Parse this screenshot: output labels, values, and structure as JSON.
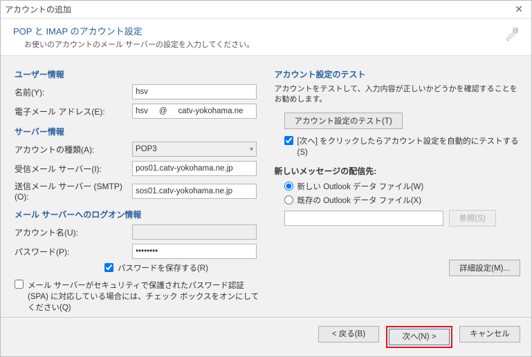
{
  "window": {
    "title": "アカウントの追加"
  },
  "header": {
    "title": "POP と IMAP のアカウント設定",
    "desc": "お使いのアカウントのメール サーバーの設定を入力してください。"
  },
  "left": {
    "user_h": "ユーザー情報",
    "name_label": "名前(Y):",
    "name_value": "hsv",
    "email_label": "電子メール アドレス(E):",
    "email_value": "hsv     @     catv-yokohama.ne",
    "server_h": "サーバー情報",
    "acct_type_label": "アカウントの種類(A):",
    "acct_type_value": "POP3",
    "incoming_label": "受信メール サーバー(I):",
    "incoming_value": "pos01.catv-yokohama.ne.jp",
    "outgoing_label": "送信メール サーバー (SMTP)(O):",
    "outgoing_value": "sos01.catv-yokohama.ne.jp",
    "logon_h": "メール サーバーへのログオン情報",
    "acct_name_label": "アカウント名(U):",
    "acct_name_value": "",
    "pwd_label": "パスワード(P):",
    "pwd_value": "••••••••",
    "remember_pwd": "パスワードを保存する(R)",
    "spa": "メール サーバーがセキュリティで保護されたパスワード認証 (SPA) に対応している場合には、チェック ボックスをオンにしてください(Q)"
  },
  "right": {
    "test_h": "アカウント設定のテスト",
    "test_desc": "アカウントをテストして、入力内容が正しいかどうかを確認することをお勧めします。",
    "test_btn": "アカウント設定のテスト(T)",
    "auto_test": "[次へ] をクリックしたらアカウント設定を自動的にテストする(S)",
    "deliver_h": "新しいメッセージの配信先:",
    "new_pst": "新しい Outlook データ ファイル(W)",
    "existing_pst": "既存の Outlook データ ファイル(X)",
    "browse": "参照(S)",
    "more": "詳細設定(M)..."
  },
  "footer": {
    "back": "< 戻る(B)",
    "next": "次へ(N) >",
    "cancel": "キャンセル"
  }
}
